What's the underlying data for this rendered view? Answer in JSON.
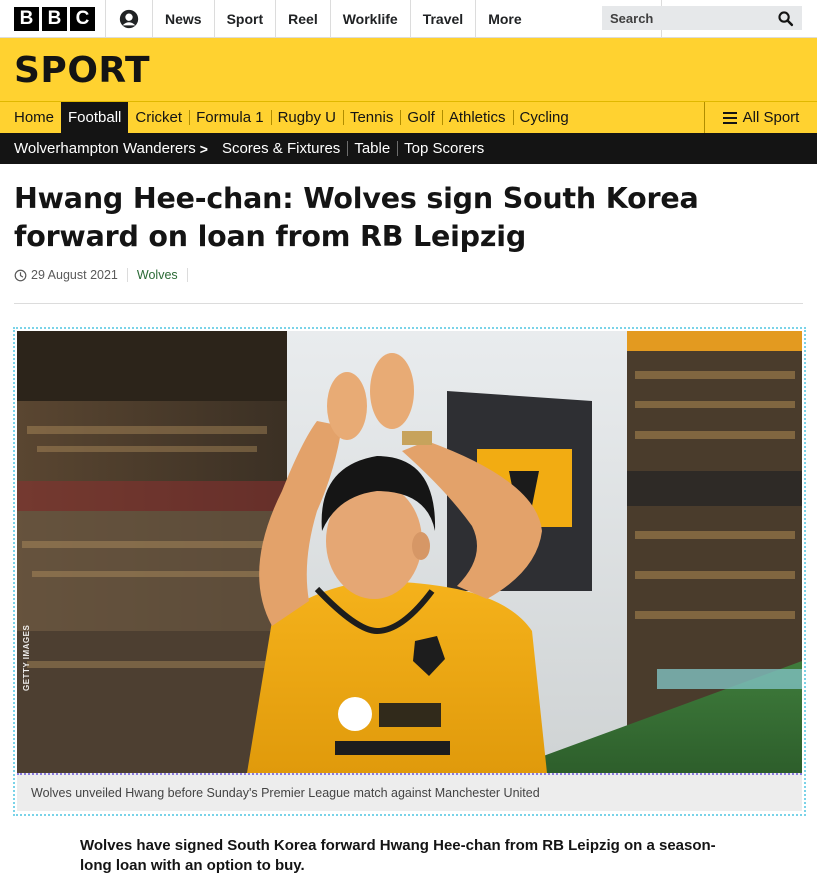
{
  "brand": {
    "letters": [
      "B",
      "B",
      "C"
    ]
  },
  "top_nav": {
    "items": [
      "News",
      "Sport",
      "Reel",
      "Worklife",
      "Travel"
    ],
    "more_label": "More",
    "search_placeholder": "Search"
  },
  "sport_header": {
    "title": "SPORT"
  },
  "sport_nav": {
    "items": [
      "Home",
      "Football",
      "Cricket",
      "Formula 1",
      "Rugby U",
      "Tennis",
      "Golf",
      "Athletics",
      "Cycling"
    ],
    "active": "Football",
    "all_sport_label": "All Sport"
  },
  "sub_nav": {
    "team": "Wolverhampton Wanderers",
    "items": [
      "Scores & Fixtures",
      "Table",
      "Top Scorers"
    ]
  },
  "article": {
    "headline": "Hwang Hee-chan: Wolves sign South Korea forward on loan from RB Leipzig",
    "date": "29 August 2021",
    "tag": "Wolves",
    "image_credit": "GETTY IMAGES",
    "caption": "Wolves unveiled Hwang before Sunday's Premier League match against Manchester United",
    "intro": "Wolves have signed South Korea forward Hwang Hee-chan from RB Leipzig on a season-long loan with an option to buy."
  },
  "colors": {
    "sport_yellow": "#ffd230",
    "nav_black": "#141414",
    "tag_green": "#2b6a36"
  }
}
